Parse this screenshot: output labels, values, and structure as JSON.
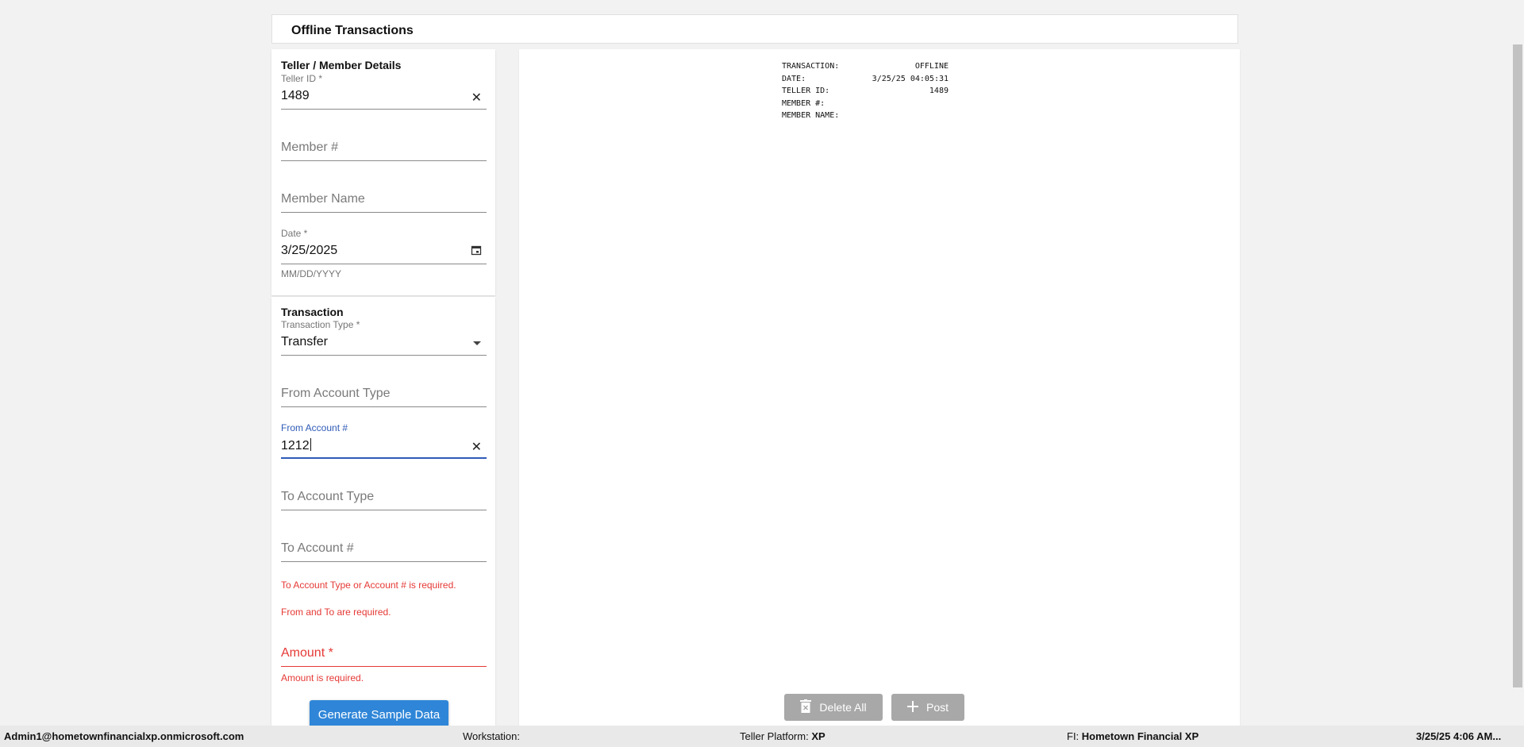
{
  "header": {
    "title": "Offline Transactions"
  },
  "details": {
    "section_title": "Teller / Member Details",
    "teller_id": {
      "label": "Teller ID *",
      "value": "1489",
      "clear_icon": "close-icon"
    },
    "member_number": {
      "placeholder": "Member #"
    },
    "member_name": {
      "placeholder": "Member Name"
    },
    "date": {
      "label": "Date *",
      "value": "3/25/2025",
      "helper": "MM/DD/YYYY",
      "icon": "calendar-icon"
    }
  },
  "transaction": {
    "section_title": "Transaction",
    "type": {
      "label": "Transaction Type *",
      "value": "Transfer",
      "icon": "dropdown-arrow-icon"
    },
    "from_account_type": {
      "placeholder": "From Account Type"
    },
    "from_account_number": {
      "label": "From Account #",
      "value": "1212",
      "clear_icon": "close-icon"
    },
    "to_account_type": {
      "placeholder": "To Account Type"
    },
    "to_account_number": {
      "placeholder": "To Account #"
    },
    "errors": {
      "to_account": "To Account Type or Account # is required.",
      "from_to": "From and To are required."
    },
    "amount": {
      "placeholder": "Amount *",
      "error": "Amount is required."
    },
    "generate_button": "Generate Sample Data"
  },
  "receipt": {
    "rows": [
      {
        "label": "TRANSACTION:",
        "value": "OFFLINE"
      },
      {
        "label": "DATE:",
        "value": "3/25/25 04:05:31"
      },
      {
        "label": "TELLER ID:",
        "value": "1489"
      },
      {
        "label": "MEMBER #:",
        "value": ""
      },
      {
        "label": "MEMBER NAME:",
        "value": ""
      }
    ],
    "delete_all_label": "Delete All",
    "post_label": "Post"
  },
  "status_bar": {
    "user": "Admin1@hometownfinancialxp.onmicrosoft.com",
    "workstation_label": "Workstation:",
    "workstation_value": "",
    "platform_label": "Teller Platform:",
    "platform_value": "XP",
    "fi_label": "FI:",
    "fi_value": "Hometown Financial XP",
    "datetime": "3/25/25 4:06 AM..."
  },
  "colors": {
    "primary": "#2f86d8",
    "error": "#e53935",
    "focus": "#2f5bb7",
    "disabled_button": "#a8a8a8"
  }
}
